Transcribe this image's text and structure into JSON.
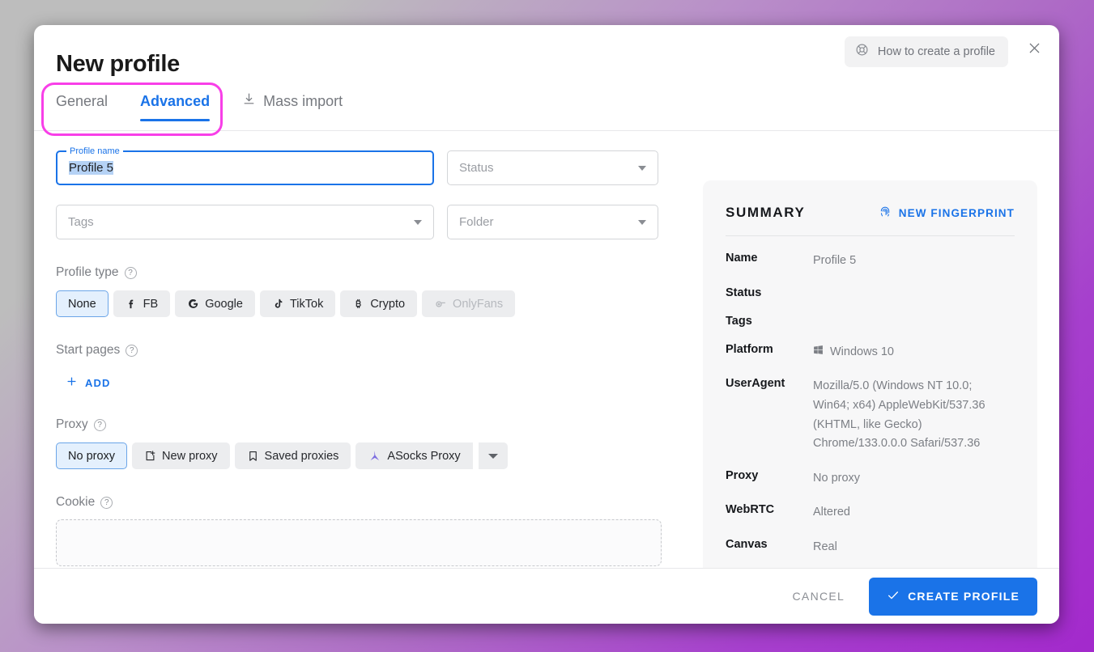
{
  "dialog": {
    "title": "New profile",
    "help_button": "How to create a profile",
    "help_icon": "lifebuoy-icon",
    "close_icon": "close-icon"
  },
  "tabs": [
    {
      "label": "General",
      "active": false,
      "icon": null
    },
    {
      "label": "Advanced",
      "active": true,
      "icon": null
    },
    {
      "label": "Mass import",
      "active": false,
      "icon": "download-icon"
    }
  ],
  "annotation": {
    "color": "#f83fe8",
    "target": "tabs-general-advanced"
  },
  "form": {
    "profile_name": {
      "legend": "Profile name",
      "value": "Profile 5",
      "selected": true
    },
    "status": {
      "placeholder": "Status"
    },
    "tags": {
      "placeholder": "Tags"
    },
    "folder": {
      "placeholder": "Folder"
    },
    "profile_type": {
      "label": "Profile type",
      "options": [
        {
          "label": "None",
          "icon": null,
          "active": true,
          "disabled": false
        },
        {
          "label": "FB",
          "icon": "facebook-icon",
          "active": false,
          "disabled": false
        },
        {
          "label": "Google",
          "icon": "google-icon",
          "active": false,
          "disabled": false
        },
        {
          "label": "TikTok",
          "icon": "tiktok-icon",
          "active": false,
          "disabled": false
        },
        {
          "label": "Crypto",
          "icon": "bitcoin-icon",
          "active": false,
          "disabled": false
        },
        {
          "label": "OnlyFans",
          "icon": "onlyfans-icon",
          "active": false,
          "disabled": true
        }
      ]
    },
    "start_pages": {
      "label": "Start pages",
      "add_label": "ADD",
      "add_icon": "plus-icon"
    },
    "proxy": {
      "label": "Proxy",
      "options": [
        {
          "label": "No proxy",
          "icon": null,
          "active": true
        },
        {
          "label": "New proxy",
          "icon": "new-window-icon",
          "active": false
        },
        {
          "label": "Saved proxies",
          "icon": "bookmark-icon",
          "active": false
        },
        {
          "label": "ASocks Proxy",
          "icon": "asocks-icon",
          "active": false
        }
      ],
      "dropdown_icon": "chevron-down-icon"
    },
    "cookie": {
      "label": "Cookie"
    }
  },
  "summary": {
    "title": "SUMMARY",
    "new_fingerprint": "NEW FINGERPRINT",
    "fingerprint_icon": "fingerprint-icon",
    "rows": [
      {
        "key": "Name",
        "value": "Profile 5",
        "icon": null
      },
      {
        "key": "Status",
        "value": "",
        "icon": null
      },
      {
        "key": "Tags",
        "value": "",
        "icon": null
      },
      {
        "key": "Platform",
        "value": "Windows 10",
        "icon": "windows-icon"
      },
      {
        "key": "UserAgent",
        "value": "Mozilla/5.0 (Windows NT 10.0; Win64; x64) AppleWebKit/537.36 (KHTML, like Gecko) Chrome/133.0.0.0 Safari/537.36",
        "icon": null
      },
      {
        "key": "Proxy",
        "value": "No proxy",
        "icon": null
      },
      {
        "key": "WebRTC",
        "value": "Altered",
        "icon": null
      },
      {
        "key": "Canvas",
        "value": "Real",
        "icon": null
      }
    ]
  },
  "footer": {
    "cancel": "CANCEL",
    "create": "CREATE PROFILE",
    "create_icon": "check-icon"
  },
  "colors": {
    "accent": "#1a73e8",
    "annotation": "#f83fe8",
    "panel": "#f7f7f8"
  }
}
